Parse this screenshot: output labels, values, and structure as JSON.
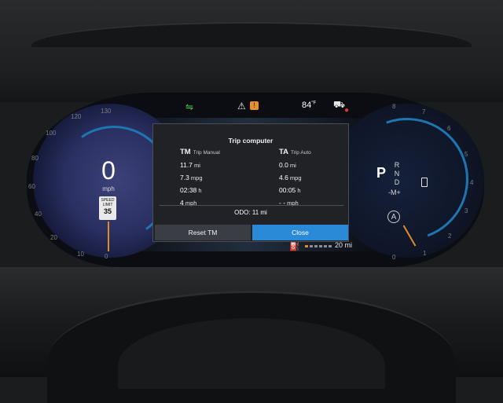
{
  "speed": {
    "value": "0",
    "unit": "mph",
    "limit_label": "SPEED LIMIT",
    "limit_value": "35"
  },
  "speed_ticks": [
    "0",
    "10",
    "20",
    "40",
    "60",
    "80",
    "100",
    "120",
    "130"
  ],
  "tach_ticks": [
    "0",
    "1",
    "2",
    "3",
    "4",
    "5",
    "6",
    "7",
    "8"
  ],
  "status": {
    "temperature": "84",
    "temperature_unit": "°F"
  },
  "gear": {
    "selected": "P",
    "others": [
      "R",
      "N",
      "D"
    ],
    "manual": "-M+"
  },
  "fuel": {
    "range": "20 mi",
    "level_fraction": 0.1,
    "accent_color": "#e08a2c"
  },
  "trip_computer": {
    "title": "Trip computer",
    "manual": {
      "code": "TM",
      "name": "Trip Manual",
      "rows": [
        {
          "value": "11.7",
          "unit": "mi"
        },
        {
          "value": "7.3",
          "unit": "mpg"
        },
        {
          "value": "02:38",
          "unit": "h"
        },
        {
          "value": "4",
          "unit": "mph"
        }
      ]
    },
    "auto": {
      "code": "TA",
      "name": "Trip Auto",
      "rows": [
        {
          "value": "0.0",
          "unit": "mi"
        },
        {
          "value": "4.6",
          "unit": "mpg"
        },
        {
          "value": "00:05",
          "unit": "h"
        },
        {
          "value": "- -",
          "unit": "mph"
        }
      ]
    },
    "odo": "ODO:  11 mi",
    "reset_label": "Reset TM",
    "close_label": "Close",
    "close_color": "#2a8ad8"
  },
  "icons": [
    "lane-assist-icon",
    "warning-triangle-icon",
    "info-icon",
    "door-open-icon",
    "seatbelt-icon",
    "fuel-pump-icon",
    "battery-icon",
    "pilot-assist-icon"
  ]
}
